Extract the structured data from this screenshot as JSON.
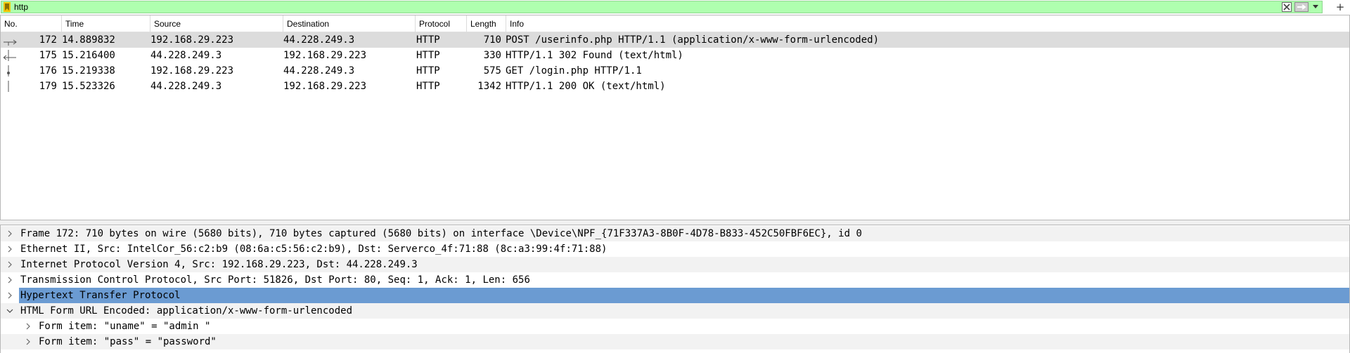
{
  "filter": {
    "value": "http",
    "bookmark_icon": "bookmark-icon",
    "clear_icon": "clear-x-icon",
    "apply_icon": "apply-arrow-icon",
    "dropdown_icon": "chevron-down-icon",
    "add_icon": "plus-icon",
    "background_color": "#afffaf"
  },
  "packet_list": {
    "columns": [
      "No.",
      "Time",
      "Source",
      "Destination",
      "Protocol",
      "Length",
      "Info"
    ],
    "rows": [
      {
        "no": "172",
        "time": "14.889832",
        "source": "192.168.29.223",
        "destination": "44.228.249.3",
        "protocol": "HTTP",
        "length": "710",
        "info": "POST /userinfo.php HTTP/1.1  (application/x-www-form-urlencoded)",
        "selected": true
      },
      {
        "no": "175",
        "time": "15.216400",
        "source": "44.228.249.3",
        "destination": "192.168.29.223",
        "protocol": "HTTP",
        "length": "330",
        "info": "HTTP/1.1 302 Found  (text/html)",
        "selected": false
      },
      {
        "no": "176",
        "time": "15.219338",
        "source": "192.168.29.223",
        "destination": "44.228.249.3",
        "protocol": "HTTP",
        "length": "575",
        "info": "GET /login.php HTTP/1.1",
        "selected": false
      },
      {
        "no": "179",
        "time": "15.523326",
        "source": "44.228.249.3",
        "destination": "192.168.29.223",
        "protocol": "HTTP",
        "length": "1342",
        "info": "HTTP/1.1 200 OK  (text/html)",
        "selected": false
      }
    ],
    "selected_row_color": "#dcdcdc"
  },
  "packet_details": {
    "items": [
      {
        "label": "Frame 172: 710 bytes on wire (5680 bits), 710 bytes captured (5680 bits) on interface \\Device\\NPF_{71F337A3-8B0F-4D78-B833-452C50FBF6EC}, id 0",
        "expanded": false
      },
      {
        "label": "Ethernet II, Src: IntelCor_56:c2:b9 (08:6a:c5:56:c2:b9), Dst: Serverco_4f:71:88 (8c:a3:99:4f:71:88)",
        "expanded": false
      },
      {
        "label": "Internet Protocol Version 4, Src: 192.168.29.223, Dst: 44.228.249.3",
        "expanded": false
      },
      {
        "label": "Transmission Control Protocol, Src Port: 51826, Dst Port: 80, Seq: 1, Ack: 1, Len: 656",
        "expanded": false
      },
      {
        "label": "Hypertext Transfer Protocol",
        "expanded": false,
        "selected": true
      },
      {
        "label": "HTML Form URL Encoded: application/x-www-form-urlencoded",
        "expanded": true
      },
      {
        "label": "Form item: \"uname\" = \"admin \"",
        "expanded": false,
        "child": true
      },
      {
        "label": "Form item: \"pass\" = \"password\"",
        "expanded": false,
        "child": true
      }
    ],
    "selected_color": "#6b9bd2",
    "alt_row_color": "#f2f2f2"
  }
}
